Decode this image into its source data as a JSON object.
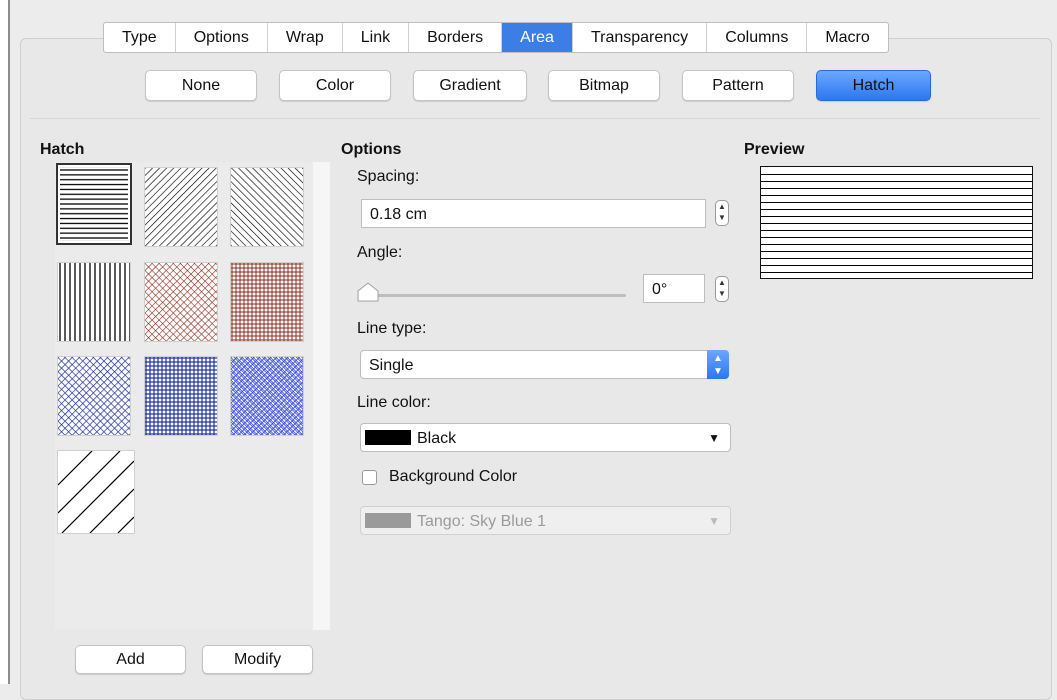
{
  "tabs": [
    "Type",
    "Options",
    "Wrap",
    "Link",
    "Borders",
    "Area",
    "Transparency",
    "Columns",
    "Macro"
  ],
  "active_tab": "Area",
  "area_buttons": {
    "none": "None",
    "color": "Color",
    "gradient": "Gradient",
    "bitmap": "Bitmap",
    "pattern": "Pattern",
    "hatch": "Hatch"
  },
  "active_area_button": "Hatch",
  "hatch": {
    "heading": "Hatch",
    "add_label": "Add",
    "modify_label": "Modify",
    "swatch_colors": {
      "black": "#000000",
      "red": "#8b2a1a",
      "blue": "#1f2f9f"
    }
  },
  "options": {
    "heading": "Options",
    "spacing_label": "Spacing:",
    "spacing_value": "0.18 cm",
    "angle_label": "Angle:",
    "angle_value": "0°",
    "angle_slider_fraction": 0.0,
    "line_type_label": "Line type:",
    "line_type_value": "Single",
    "line_color_label": "Line color:",
    "line_color_value": "Black",
    "line_color_hex": "#000000",
    "background_color_label": "Background Color",
    "background_color_checked": false,
    "background_color_value": "Tango: Sky Blue 1",
    "background_color_hex": "#9a9a9a"
  },
  "preview": {
    "heading": "Preview"
  },
  "accent_color": "#3b7fe6"
}
